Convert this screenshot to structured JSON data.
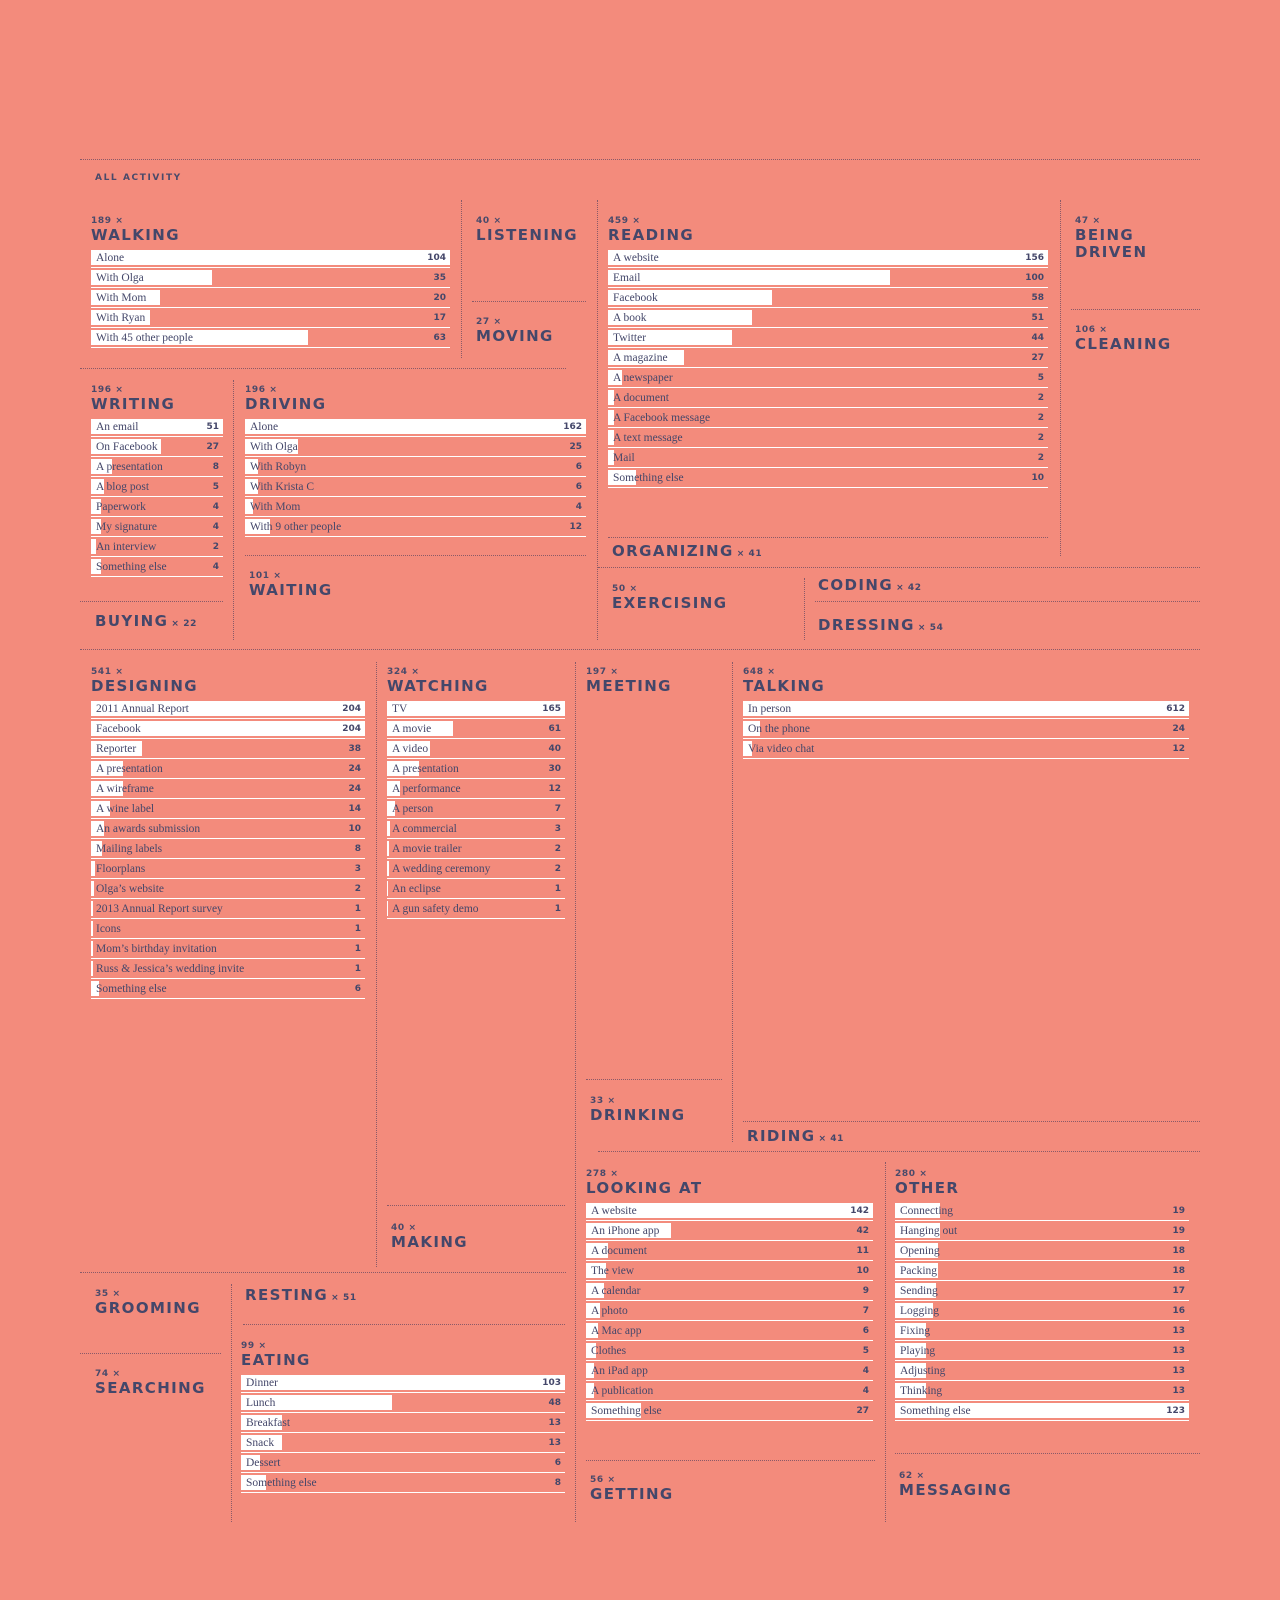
{
  "header": {
    "label": "ALL ACTIVITY"
  },
  "chart_data": [
    {
      "type": "bar",
      "key": "walking",
      "title": "WALKING",
      "count": "189",
      "categories": [
        "Alone",
        "With Olga",
        "With Mom",
        "With Ryan",
        "With 45 other people"
      ],
      "values": [
        104,
        35,
        20,
        17,
        63
      ]
    },
    {
      "type": "bar",
      "key": "listening",
      "title": "LISTENING",
      "count": "40",
      "categories": [],
      "values": []
    },
    {
      "type": "bar",
      "key": "moving",
      "title": "MOVING",
      "count": "27",
      "categories": [],
      "values": []
    },
    {
      "type": "bar",
      "key": "reading",
      "title": "READING",
      "count": "459",
      "categories": [
        "A website",
        "Email",
        "Facebook",
        "A book",
        "Twitter",
        "A magazine",
        "A newspaper",
        "A document",
        "A Facebook message",
        "A text message",
        "Mail",
        "Something else"
      ],
      "values": [
        156,
        100,
        58,
        51,
        44,
        27,
        5,
        2,
        2,
        2,
        2,
        10
      ]
    },
    {
      "type": "bar",
      "key": "being_driven",
      "title": "BEING DRIVEN",
      "count": "47",
      "categories": [],
      "values": []
    },
    {
      "type": "bar",
      "key": "cleaning",
      "title": "CLEANING",
      "count": "106",
      "categories": [],
      "values": []
    },
    {
      "type": "bar",
      "key": "writing",
      "title": "WRITING",
      "count": "196",
      "categories": [
        "An email",
        "On Facebook",
        "A presentation",
        "A blog post",
        "Paperwork",
        "My signature",
        "An interview",
        "Something else"
      ],
      "values": [
        51,
        27,
        8,
        5,
        4,
        4,
        2,
        4
      ]
    },
    {
      "type": "bar",
      "key": "driving",
      "title": "DRIVING",
      "count": "196",
      "categories": [
        "Alone",
        "With Olga",
        "With Robyn",
        "With Krista C",
        "With Mom",
        "With 9 other people"
      ],
      "values": [
        162,
        25,
        6,
        6,
        4,
        12
      ]
    },
    {
      "type": "bar",
      "key": "waiting",
      "title": "WAITING",
      "count": "101",
      "categories": [],
      "values": []
    },
    {
      "type": "bar",
      "key": "buying",
      "title": "BUYING",
      "count": "22",
      "categories": [],
      "values": []
    },
    {
      "type": "bar",
      "key": "organizing",
      "title": "ORGANIZING",
      "count": "41",
      "categories": [],
      "values": []
    },
    {
      "type": "bar",
      "key": "exercising",
      "title": "EXERCISING",
      "count": "50",
      "categories": [],
      "values": []
    },
    {
      "type": "bar",
      "key": "coding",
      "title": "CODING",
      "count": "42",
      "categories": [],
      "values": []
    },
    {
      "type": "bar",
      "key": "dressing",
      "title": "DRESSING",
      "count": "54",
      "categories": [],
      "values": []
    },
    {
      "type": "bar",
      "key": "designing",
      "title": "DESIGNING",
      "count": "541",
      "categories": [
        "2011 Annual Report",
        "Facebook",
        "Reporter",
        "A presentation",
        "A wireframe",
        "A wine label",
        "An awards submission",
        "Mailing labels",
        "Floorplans",
        "Olga’s website",
        "2013 Annual Report survey",
        "Icons",
        "Mom’s birthday invitation",
        "Russ & Jessica’s wedding invite",
        "Something else"
      ],
      "values": [
        204,
        204,
        38,
        24,
        24,
        14,
        10,
        8,
        3,
        2,
        1,
        1,
        1,
        1,
        6
      ]
    },
    {
      "type": "bar",
      "key": "watching",
      "title": "WATCHING",
      "count": "324",
      "categories": [
        "TV",
        "A movie",
        "A video",
        "A presentation",
        "A performance",
        "A person",
        "A commercial",
        "A movie trailer",
        "A wedding ceremony",
        "An eclipse",
        "A gun safety demo"
      ],
      "values": [
        165,
        61,
        40,
        30,
        12,
        7,
        3,
        2,
        2,
        1,
        1
      ]
    },
    {
      "type": "bar",
      "key": "meeting",
      "title": "MEETING",
      "count": "197",
      "categories": [],
      "values": []
    },
    {
      "type": "bar",
      "key": "talking",
      "title": "TALKING",
      "count": "648",
      "categories": [
        "In person",
        "On the phone",
        "Via video chat"
      ],
      "values": [
        612,
        24,
        12
      ]
    },
    {
      "type": "bar",
      "key": "drinking",
      "title": "DRINKING",
      "count": "33",
      "categories": [],
      "values": []
    },
    {
      "type": "bar",
      "key": "riding",
      "title": "RIDING",
      "count": "41",
      "categories": [],
      "values": []
    },
    {
      "type": "bar",
      "key": "making",
      "title": "MAKING",
      "count": "40",
      "categories": [],
      "values": []
    },
    {
      "type": "bar",
      "key": "looking_at",
      "title": "LOOKING AT",
      "count": "278",
      "categories": [
        "A website",
        "An iPhone app",
        "A document",
        "The view",
        "A calendar",
        "A photo",
        "A Mac app",
        "Clothes",
        "An iPad app",
        "A publication",
        "Something else"
      ],
      "values": [
        142,
        42,
        11,
        10,
        9,
        7,
        6,
        5,
        4,
        4,
        27
      ]
    },
    {
      "type": "bar",
      "key": "other",
      "title": "OTHER",
      "count": "280",
      "categories": [
        "Connecting",
        "Hanging out",
        "Opening",
        "Packing",
        "Sending",
        "Logging",
        "Fixing",
        "Playing",
        "Adjusting",
        "Thinking",
        "Something else"
      ],
      "values": [
        19,
        19,
        18,
        18,
        17,
        16,
        13,
        13,
        13,
        13,
        123
      ]
    },
    {
      "type": "bar",
      "key": "grooming",
      "title": "GROOMING",
      "count": "35",
      "categories": [],
      "values": []
    },
    {
      "type": "bar",
      "key": "resting",
      "title": "RESTING",
      "count": "51",
      "categories": [],
      "values": []
    },
    {
      "type": "bar",
      "key": "searching",
      "title": "SEARCHING",
      "count": "74",
      "categories": [],
      "values": []
    },
    {
      "type": "bar",
      "key": "eating",
      "title": "EATING",
      "count": "99",
      "categories": [
        "Dinner",
        "Lunch",
        "Breakfast",
        "Snack",
        "Dessert",
        "Something else"
      ],
      "values": [
        103,
        48,
        13,
        13,
        6,
        8
      ]
    },
    {
      "type": "bar",
      "key": "getting",
      "title": "GETTING",
      "count": "56",
      "categories": [],
      "values": []
    },
    {
      "type": "bar",
      "key": "messaging",
      "title": "MESSAGING",
      "count": "62",
      "categories": [],
      "values": []
    }
  ]
}
